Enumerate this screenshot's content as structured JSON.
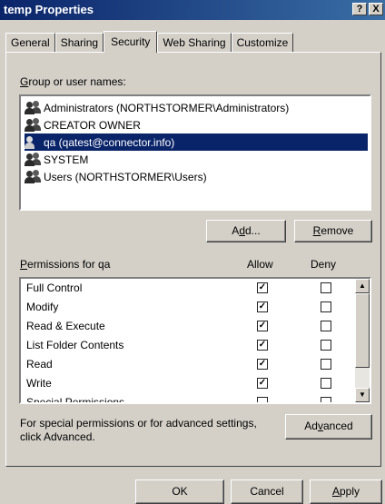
{
  "window": {
    "title": "temp Properties",
    "help_btn": "?",
    "close_btn": "X"
  },
  "tabs": [
    {
      "label": "General"
    },
    {
      "label": "Sharing"
    },
    {
      "label": "Security"
    },
    {
      "label": "Web Sharing"
    },
    {
      "label": "Customize"
    }
  ],
  "security": {
    "group_label_accel": "G",
    "group_label_rest": "roup or user names:",
    "users": [
      {
        "label": "Administrators (NORTHSTORMER\\Administrators)",
        "icon": "users-group-icon"
      },
      {
        "label": "CREATOR OWNER",
        "icon": "users-group-icon"
      },
      {
        "label": "qa (qatest@connector.info)",
        "icon": "user-icon",
        "selected": true
      },
      {
        "label": "SYSTEM",
        "icon": "users-group-icon"
      },
      {
        "label": "Users (NORTHSTORMER\\Users)",
        "icon": "users-group-icon"
      }
    ],
    "add_pre": "A",
    "add_accel": "d",
    "add_post": "d...",
    "remove_accel": "R",
    "remove_rest": "emove",
    "perm_label_accel": "P",
    "perm_label_rest": "ermissions for qa",
    "allow_header": "Allow",
    "deny_header": "Deny",
    "permissions": [
      {
        "name": "Full Control",
        "allow": true,
        "deny": false
      },
      {
        "name": "Modify",
        "allow": true,
        "deny": false
      },
      {
        "name": "Read & Execute",
        "allow": true,
        "deny": false
      },
      {
        "name": "List Folder Contents",
        "allow": true,
        "deny": false
      },
      {
        "name": "Read",
        "allow": true,
        "deny": false
      },
      {
        "name": "Write",
        "allow": true,
        "deny": false
      },
      {
        "name": "Special Permissions",
        "allow": false,
        "deny": false
      }
    ],
    "advanced_text_line1": "For special permissions or for advanced settings,",
    "advanced_text_line2": "click Advanced.",
    "advanced_pre": "Ad",
    "advanced_accel": "v",
    "advanced_post": "anced"
  },
  "footer": {
    "ok": "OK",
    "cancel": "Cancel",
    "apply_accel": "A",
    "apply_rest": "pply"
  },
  "check_glyph": "✓"
}
